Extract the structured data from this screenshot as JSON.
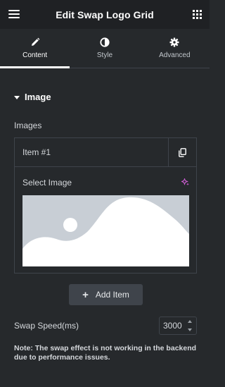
{
  "header": {
    "title": "Edit Swap Logo Grid",
    "menu_icon": "hamburger-icon",
    "apps_icon": "grid-icon"
  },
  "tabs": [
    {
      "label": "Content",
      "icon": "pencil-icon",
      "active": true
    },
    {
      "label": "Style",
      "icon": "half-circle-icon",
      "active": false
    },
    {
      "label": "Advanced",
      "icon": "gear-icon",
      "active": false
    }
  ],
  "section": {
    "title": "Image",
    "expanded": true
  },
  "images_control": {
    "label": "Images",
    "items": [
      {
        "title": "Item #1",
        "select_label": "Select Image",
        "ai_icon": "sparkle-icon",
        "duplicate_icon": "copy-icon"
      }
    ],
    "add_label": "Add Item"
  },
  "swap_speed": {
    "label": "Swap Speed(ms)",
    "value": "3000"
  },
  "note": "Note: The swap effect is not working in the backend due to performance issues.",
  "colors": {
    "background": "#26292c",
    "header": "#1f2124",
    "border": "#3f444b",
    "accent_sparkle": "#d35fd8",
    "placeholder_bg": "#c8ced5",
    "placeholder_fg": "#ffffff"
  }
}
